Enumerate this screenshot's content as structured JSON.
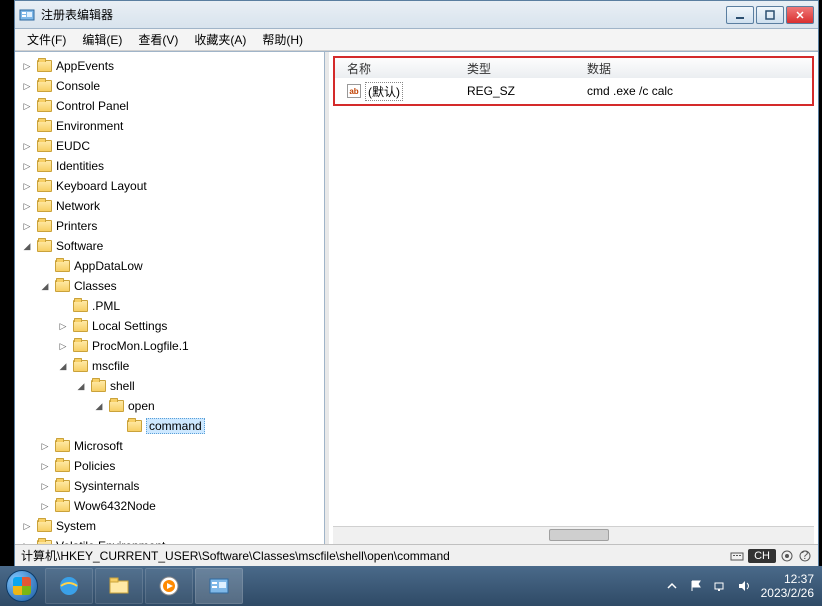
{
  "window": {
    "title": "注册表编辑器",
    "path": "计算机\\HKEY_CURRENT_USER\\Software\\Classes\\mscfile\\shell\\open\\command"
  },
  "menu": {
    "file": "文件(F)",
    "edit": "编辑(E)",
    "view": "查看(V)",
    "favorites": "收藏夹(A)",
    "help": "帮助(H)"
  },
  "tree": {
    "items": [
      {
        "label": "AppEvents",
        "kind": "closed"
      },
      {
        "label": "Console",
        "kind": "closed"
      },
      {
        "label": "Control Panel",
        "kind": "closed"
      },
      {
        "label": "Environment",
        "kind": "leaf"
      },
      {
        "label": "EUDC",
        "kind": "closed"
      },
      {
        "label": "Identities",
        "kind": "closed"
      },
      {
        "label": "Keyboard Layout",
        "kind": "closed"
      },
      {
        "label": "Network",
        "kind": "closed"
      },
      {
        "label": "Printers",
        "kind": "closed"
      },
      {
        "label": "Software",
        "kind": "open",
        "children": [
          {
            "label": "AppDataLow",
            "kind": "leaf"
          },
          {
            "label": "Classes",
            "kind": "open",
            "children": [
              {
                "label": ".PML",
                "kind": "leaf"
              },
              {
                "label": "Local Settings",
                "kind": "closed"
              },
              {
                "label": "ProcMon.Logfile.1",
                "kind": "closed"
              },
              {
                "label": "mscfile",
                "kind": "open",
                "children": [
                  {
                    "label": "shell",
                    "kind": "open",
                    "children": [
                      {
                        "label": "open",
                        "kind": "open",
                        "children": [
                          {
                            "label": "command",
                            "kind": "leaf",
                            "selected": true
                          }
                        ]
                      }
                    ]
                  }
                ]
              }
            ]
          },
          {
            "label": "Microsoft",
            "kind": "closed"
          },
          {
            "label": "Policies",
            "kind": "closed"
          },
          {
            "label": "Sysinternals",
            "kind": "closed"
          },
          {
            "label": "Wow6432Node",
            "kind": "closed"
          }
        ]
      },
      {
        "label": "System",
        "kind": "closed"
      },
      {
        "label": "Volatile Environment",
        "kind": "closed"
      }
    ]
  },
  "list": {
    "columns": {
      "name": "名称",
      "type": "类型",
      "data": "数据"
    },
    "rows": [
      {
        "name": "(默认)",
        "type": "REG_SZ",
        "data": "cmd .exe /c calc"
      }
    ]
  },
  "status": {
    "lang": "CH"
  },
  "taskbar": {
    "time": "12:37",
    "date": "2023/2/26"
  }
}
